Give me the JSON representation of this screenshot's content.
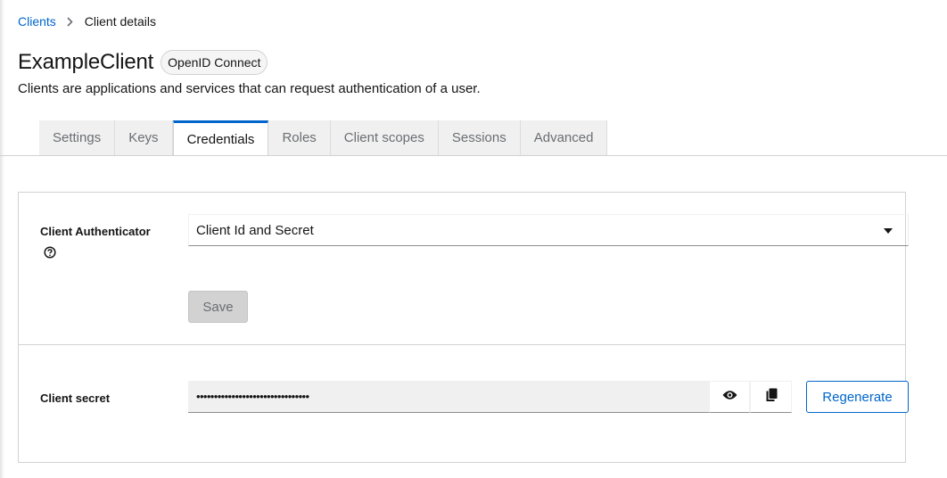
{
  "breadcrumb": {
    "parent": "Clients",
    "current": "Client details"
  },
  "header": {
    "title": "ExampleClient",
    "protocol_badge": "OpenID Connect",
    "subtitle": "Clients are applications and services that can request authentication of a user."
  },
  "tabs": [
    {
      "label": "Settings",
      "active": false
    },
    {
      "label": "Keys",
      "active": false
    },
    {
      "label": "Credentials",
      "active": true
    },
    {
      "label": "Roles",
      "active": false
    },
    {
      "label": "Client scopes",
      "active": false
    },
    {
      "label": "Sessions",
      "active": false
    },
    {
      "label": "Advanced",
      "active": false
    }
  ],
  "credentials": {
    "authenticator_label": "Client Authenticator",
    "authenticator_value": "Client Id and Secret",
    "save_label": "Save",
    "secret_label": "Client secret",
    "secret_masked": "••••••••••••••••••••••••••••••••",
    "regenerate_label": "Regenerate"
  },
  "icons": {
    "breadcrumb_separator": "chevron-right-icon",
    "help": "help-icon",
    "dropdown": "caret-down-icon",
    "show_secret": "eye-icon",
    "copy_secret": "copy-icon"
  },
  "colors": {
    "accent": "#0066cc",
    "disabled_button": "#d2d2d2",
    "tab_background": "#f0f0f0"
  }
}
